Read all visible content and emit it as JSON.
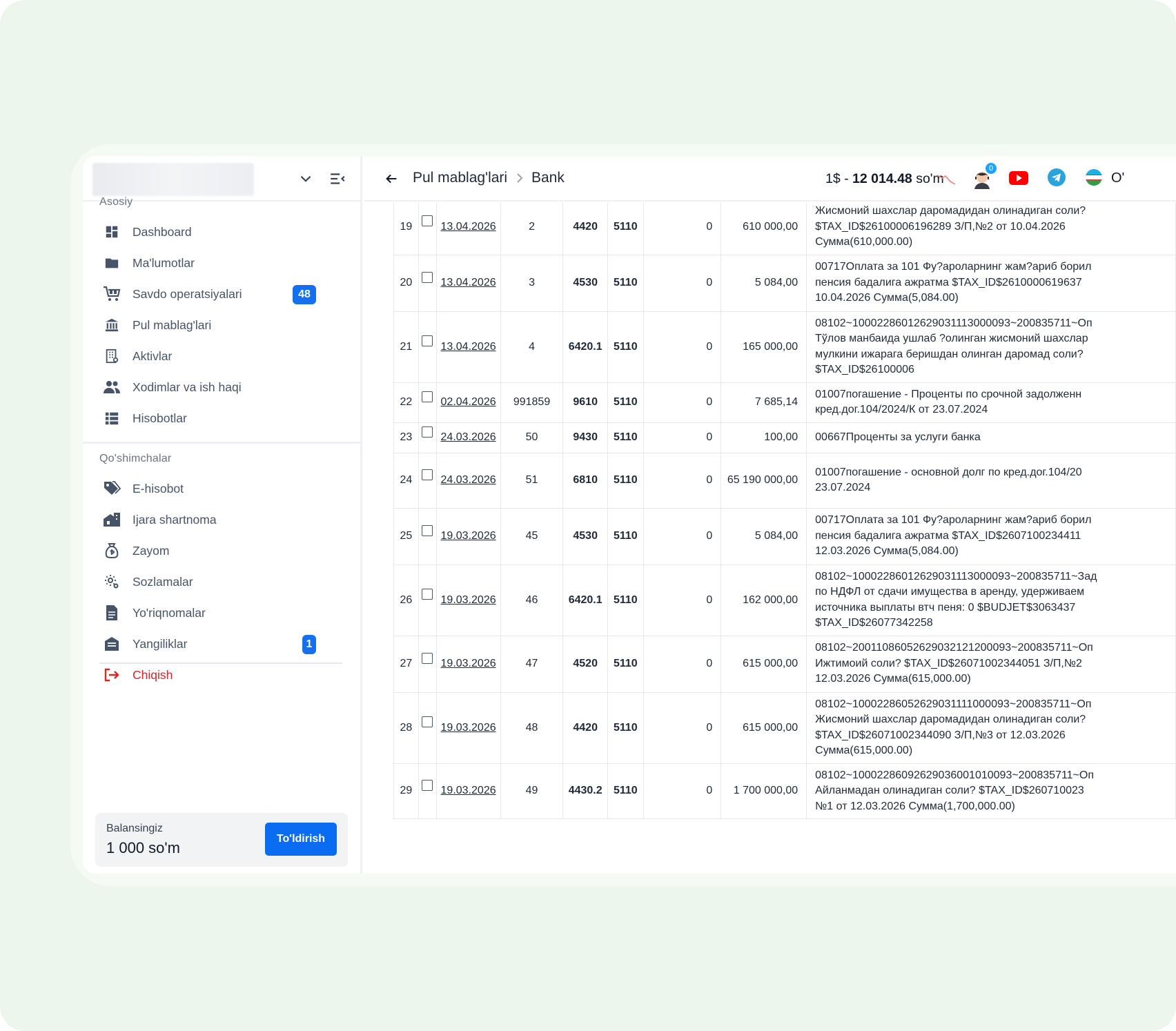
{
  "sidebar": {
    "sections": {
      "main": "Asosiy",
      "extra": "Qo'shimchalar"
    },
    "items": [
      {
        "label": "Dashboard",
        "icon": "dashboard-icon"
      },
      {
        "label": "Ma'lumotlar",
        "icon": "folder-icon"
      },
      {
        "label": "Savdo operatsiyalari",
        "icon": "cart-icon",
        "badge": "48"
      },
      {
        "label": "Pul mablag'lari",
        "icon": "bank-icon"
      },
      {
        "label": "Aktivlar",
        "icon": "building-icon"
      },
      {
        "label": "Xodimlar va ish haqi",
        "icon": "users-icon"
      },
      {
        "label": "Hisobotlar",
        "icon": "list-icon"
      }
    ],
    "extra_items": [
      {
        "label": "E-hisobot",
        "icon": "tag-icon"
      },
      {
        "label": "Ijara shartnoma",
        "icon": "warehouse-icon"
      },
      {
        "label": "Zayom",
        "icon": "money-bag-icon"
      },
      {
        "label": "Sozlamalar",
        "icon": "gear-icon"
      },
      {
        "label": "Yo'riqnomalar",
        "icon": "document-icon"
      },
      {
        "label": "Yangiliklar",
        "icon": "news-icon",
        "badge": "1"
      }
    ],
    "exit": {
      "label": "Chiqish",
      "icon": "logout-icon"
    },
    "balance": {
      "label": "Balansingiz",
      "value": "1 000 so'm",
      "button": "To'ldirish"
    }
  },
  "header": {
    "breadcrumb": [
      "Pul mablag'lari",
      "Bank"
    ],
    "rate_prefix": "1$ - ",
    "rate_value": "12 014.48",
    "rate_suffix": " so'm",
    "notifications": "0",
    "language": "O'"
  },
  "colors": {
    "accent": "#0a6cf0",
    "exit": "#dc2626",
    "badge": "#1570ef"
  },
  "table": {
    "rows": [
      {
        "n": "19",
        "date": "13.04.2026",
        "doc": "2",
        "debit": "4420",
        "credit": "5110",
        "zero": "0",
        "amount": "610 000,00",
        "desc": [
          "Жисмоний шахслар даромадидан олинадиган соли?",
          "$TAX_ID$26100006196289 З/П,№2 от 10.04.2026",
          "Сумма(610,000.00)"
        ]
      },
      {
        "n": "20",
        "date": "13.04.2026",
        "doc": "3",
        "debit": "4530",
        "credit": "5110",
        "zero": "0",
        "amount": "5 084,00",
        "desc": [
          "00717Оплата за 101 Фу?аролар­нинг жам?ариб борил",
          "пенсия бадалига ажратма $TAX_ID$2610000619637",
          "10.04.2026 Сумма(5,084.00)"
        ]
      },
      {
        "n": "21",
        "date": "13.04.2026",
        "doc": "4",
        "debit": "6420.1",
        "credit": "5110",
        "zero": "0",
        "amount": "165 000,00",
        "desc": [
          "08102~10002286012629031113000093~200835711~Оп",
          "Тўлов манбаида ушлаб ?олинган жисмоний шахслар",
          "мулкини ижарага беришдан олинган даромад соли?",
          "$TAX_ID$26100006"
        ]
      },
      {
        "n": "22",
        "date": "02.04.2026",
        "doc": "991859",
        "debit": "9610",
        "credit": "5110",
        "zero": "0",
        "amount": "7 685,14",
        "desc": [
          "01007погашение - Проценты по срочной задолженн",
          "кред.дог.104/2024/К от 23.07.2024"
        ]
      },
      {
        "n": "23",
        "date": "24.03.2026",
        "doc": "50",
        "debit": "9430",
        "credit": "5110",
        "zero": "0",
        "amount": "100,00",
        "desc": [
          "00667Проценты за услуги банка"
        ]
      },
      {
        "n": "24",
        "date": "24.03.2026",
        "doc": "51",
        "debit": "6810",
        "credit": "5110",
        "zero": "0",
        "amount": "65 190 000,00",
        "desc": [
          "01007погашение - основной долг по кред.дог.104/20",
          "23.07.2024"
        ]
      },
      {
        "n": "25",
        "date": "19.03.2026",
        "doc": "45",
        "debit": "4530",
        "credit": "5110",
        "zero": "0",
        "amount": "5 084,00",
        "desc": [
          "00717Оплата за 101 Фу?аролар­нинг жам?ариб борил",
          "пенсия бадалига ажратма $TAX_ID$2607100234411",
          "12.03.2026 Сумма(5,084.00)"
        ]
      },
      {
        "n": "26",
        "date": "19.03.2026",
        "doc": "46",
        "debit": "6420.1",
        "credit": "5110",
        "zero": "0",
        "amount": "162 000,00",
        "desc": [
          "08102~10002286012629031113000093~200835711~Зад",
          "по НДФЛ от сдачи имущества в аренду, удерживаем",
          "источника выплаты втч пеня: 0 $BUDJET$3063437",
          "$TAX_ID$26077342258"
        ]
      },
      {
        "n": "27",
        "date": "19.03.2026",
        "doc": "47",
        "debit": "4520",
        "credit": "5110",
        "zero": "0",
        "amount": "615 000,00",
        "desc": [
          "08102~20011086052629032121200093~200835711~Оп",
          "Ижтимоий соли? $TAX_ID$26071002344051 З/П,№2",
          "12.03.2026 Сумма(615,000.00)"
        ]
      },
      {
        "n": "28",
        "date": "19.03.2026",
        "doc": "48",
        "debit": "4420",
        "credit": "5110",
        "zero": "0",
        "amount": "615 000,00",
        "desc": [
          "08102~10002286052629031111000093~200835711~Оп",
          "Жисмоний шахслар даромадидан олинадиган соли?",
          "$TAX_ID$26071002344090 З/П,№3 от 12.03.2026",
          "Сумма(615,000.00)"
        ]
      },
      {
        "n": "29",
        "date": "19.03.2026",
        "doc": "49",
        "debit": "4430.2",
        "credit": "5110",
        "zero": "0",
        "amount": "1 700 000,00",
        "desc": [
          "08102~10002286092629036001010093~200835711~Оп",
          "Айланмадан олинадиган соли? $TAX_ID$260710023",
          "№1 от 12.03.2026 Сумма(1,700,000.00)"
        ]
      }
    ]
  }
}
